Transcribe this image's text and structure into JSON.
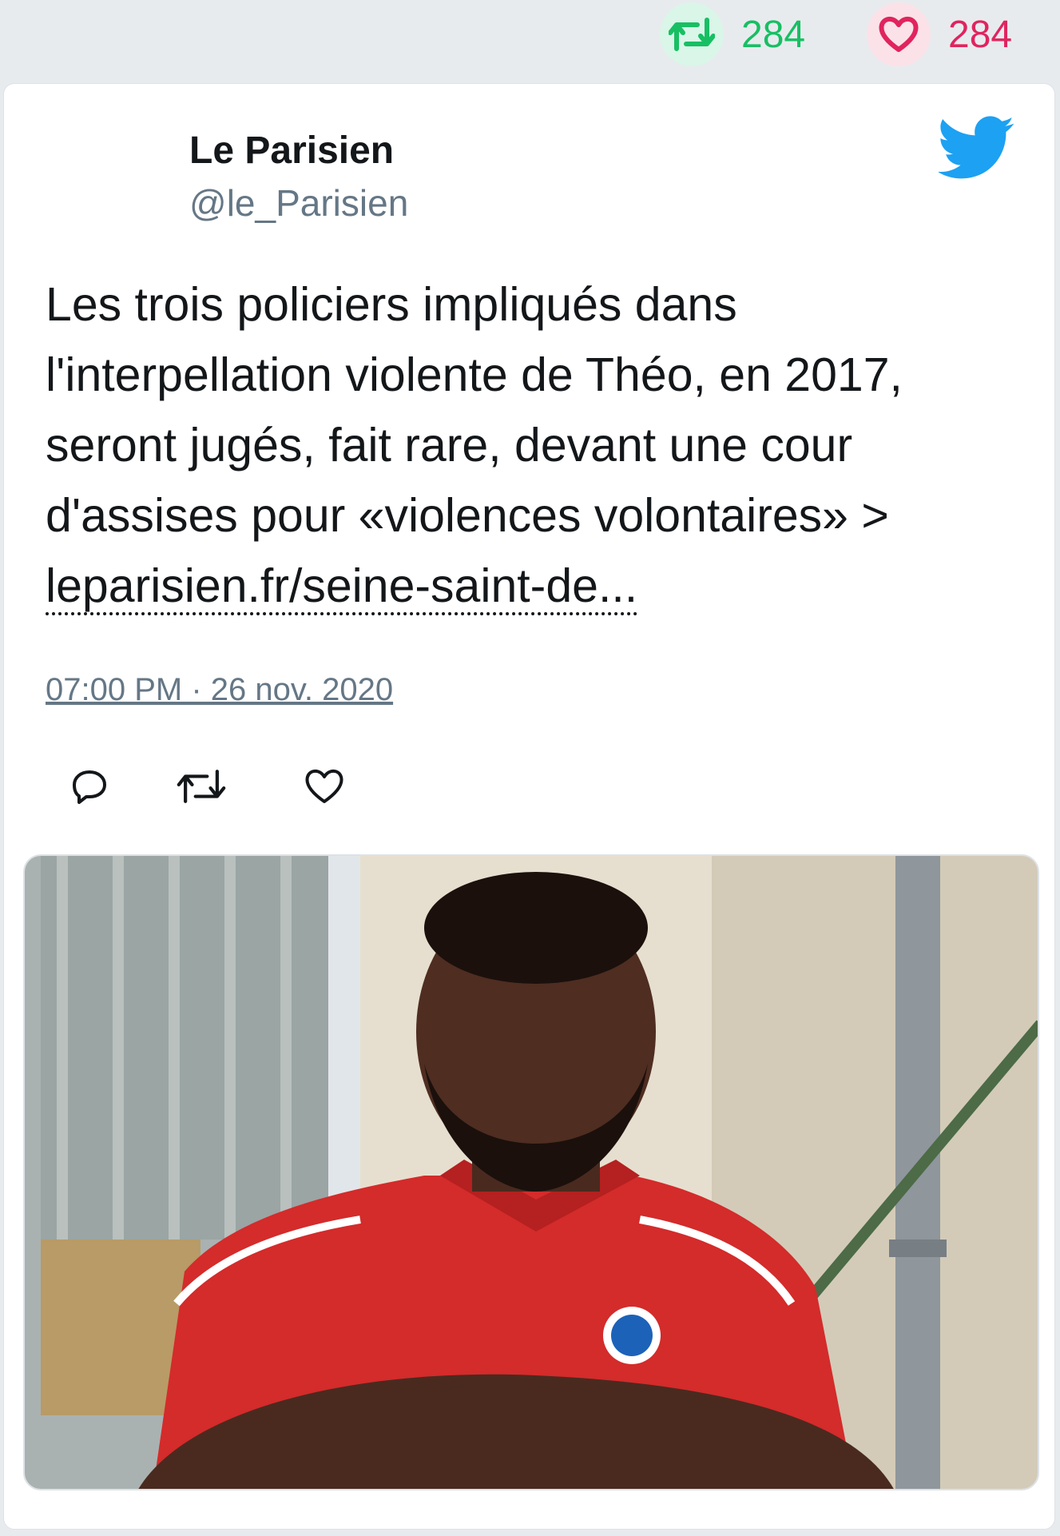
{
  "stats": {
    "retweets": "284",
    "likes": "284",
    "retweet_color": "#17bf63",
    "like_color": "#e0245e"
  },
  "tweet": {
    "author_name": "Le Parisien",
    "author_handle": "@le_Parisien",
    "text": "Les trois policiers impliqués dans l'interpellation violente de Théo, en 2017, seront jugés, fait rare, devant une cour d'assises pour «violences volontaires» >",
    "link": "leparisien.fr/seine-saint-de...",
    "timestamp": "07:00 PM · 26 nov. 2020",
    "brand_color": "#1da1f2"
  },
  "actions": {
    "reply_icon": "reply-icon",
    "retweet_icon": "retweet-icon",
    "like_icon": "heart-icon"
  },
  "media": {
    "icon": "photo"
  }
}
